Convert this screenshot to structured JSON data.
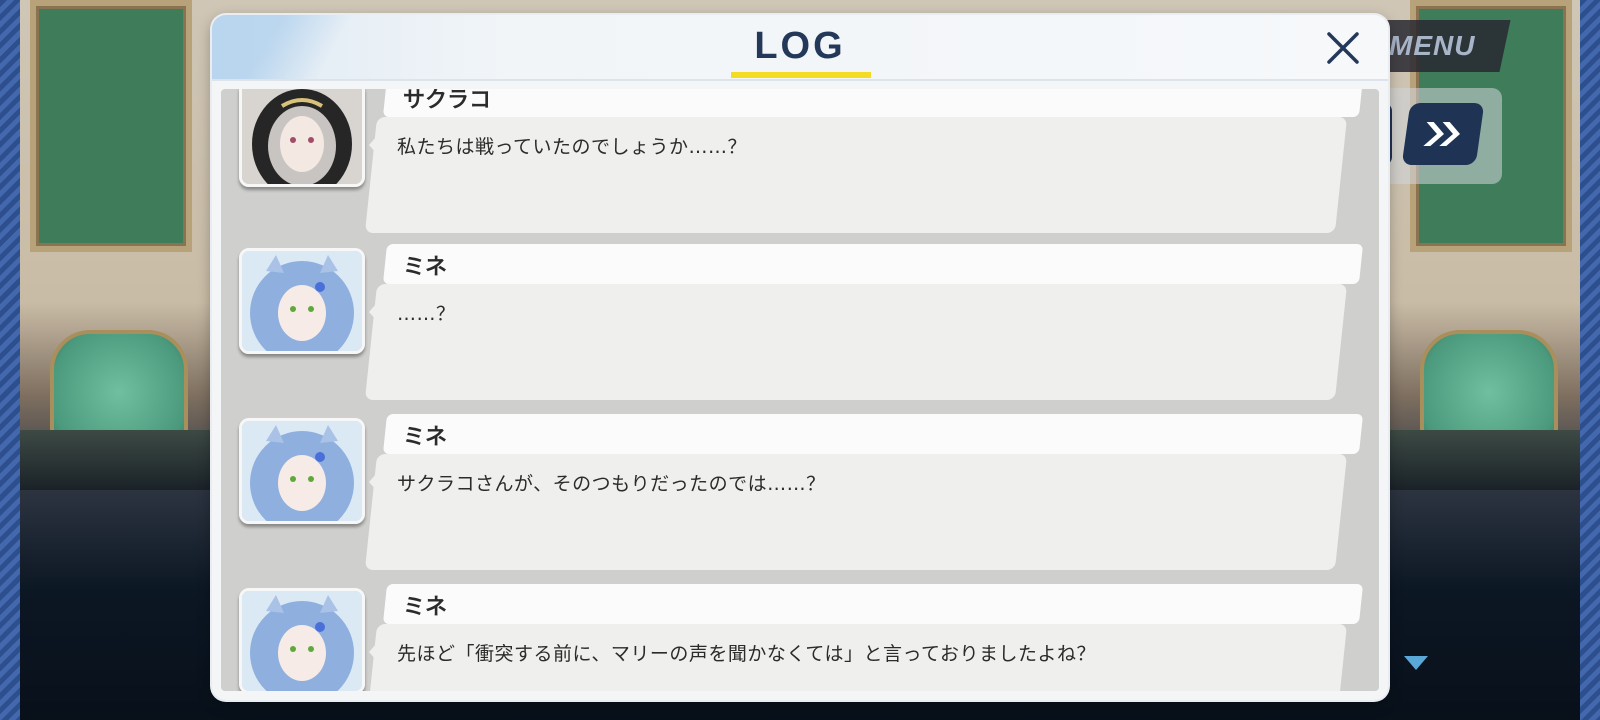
{
  "hud": {
    "menu_label": "MENU",
    "fast_forward_icon": "double-chevron-right-icon",
    "scroll_indicator_icon": "triangle-down-icon"
  },
  "log": {
    "title": "LOG",
    "close_icon": "close-icon",
    "entries": [
      {
        "speaker": "サクラコ",
        "text": "私たちは戦っていたのでしょうか……？",
        "avatar": "sakurako-portrait"
      },
      {
        "speaker": "ミネ",
        "text": "……？",
        "avatar": "mine-portrait"
      },
      {
        "speaker": "ミネ",
        "text": "サクラコさんが、そのつもりだったのでは……？",
        "avatar": "mine-portrait"
      },
      {
        "speaker": "ミネ",
        "text": "先ほど「衝突する前に、マリーの声を聞かなくては」と言っておりましたよね？",
        "avatar": "mine-portrait"
      }
    ]
  },
  "colors": {
    "title_underline": "#f5dc24",
    "title_text": "#24385a",
    "hud_button": "#1f3454"
  }
}
